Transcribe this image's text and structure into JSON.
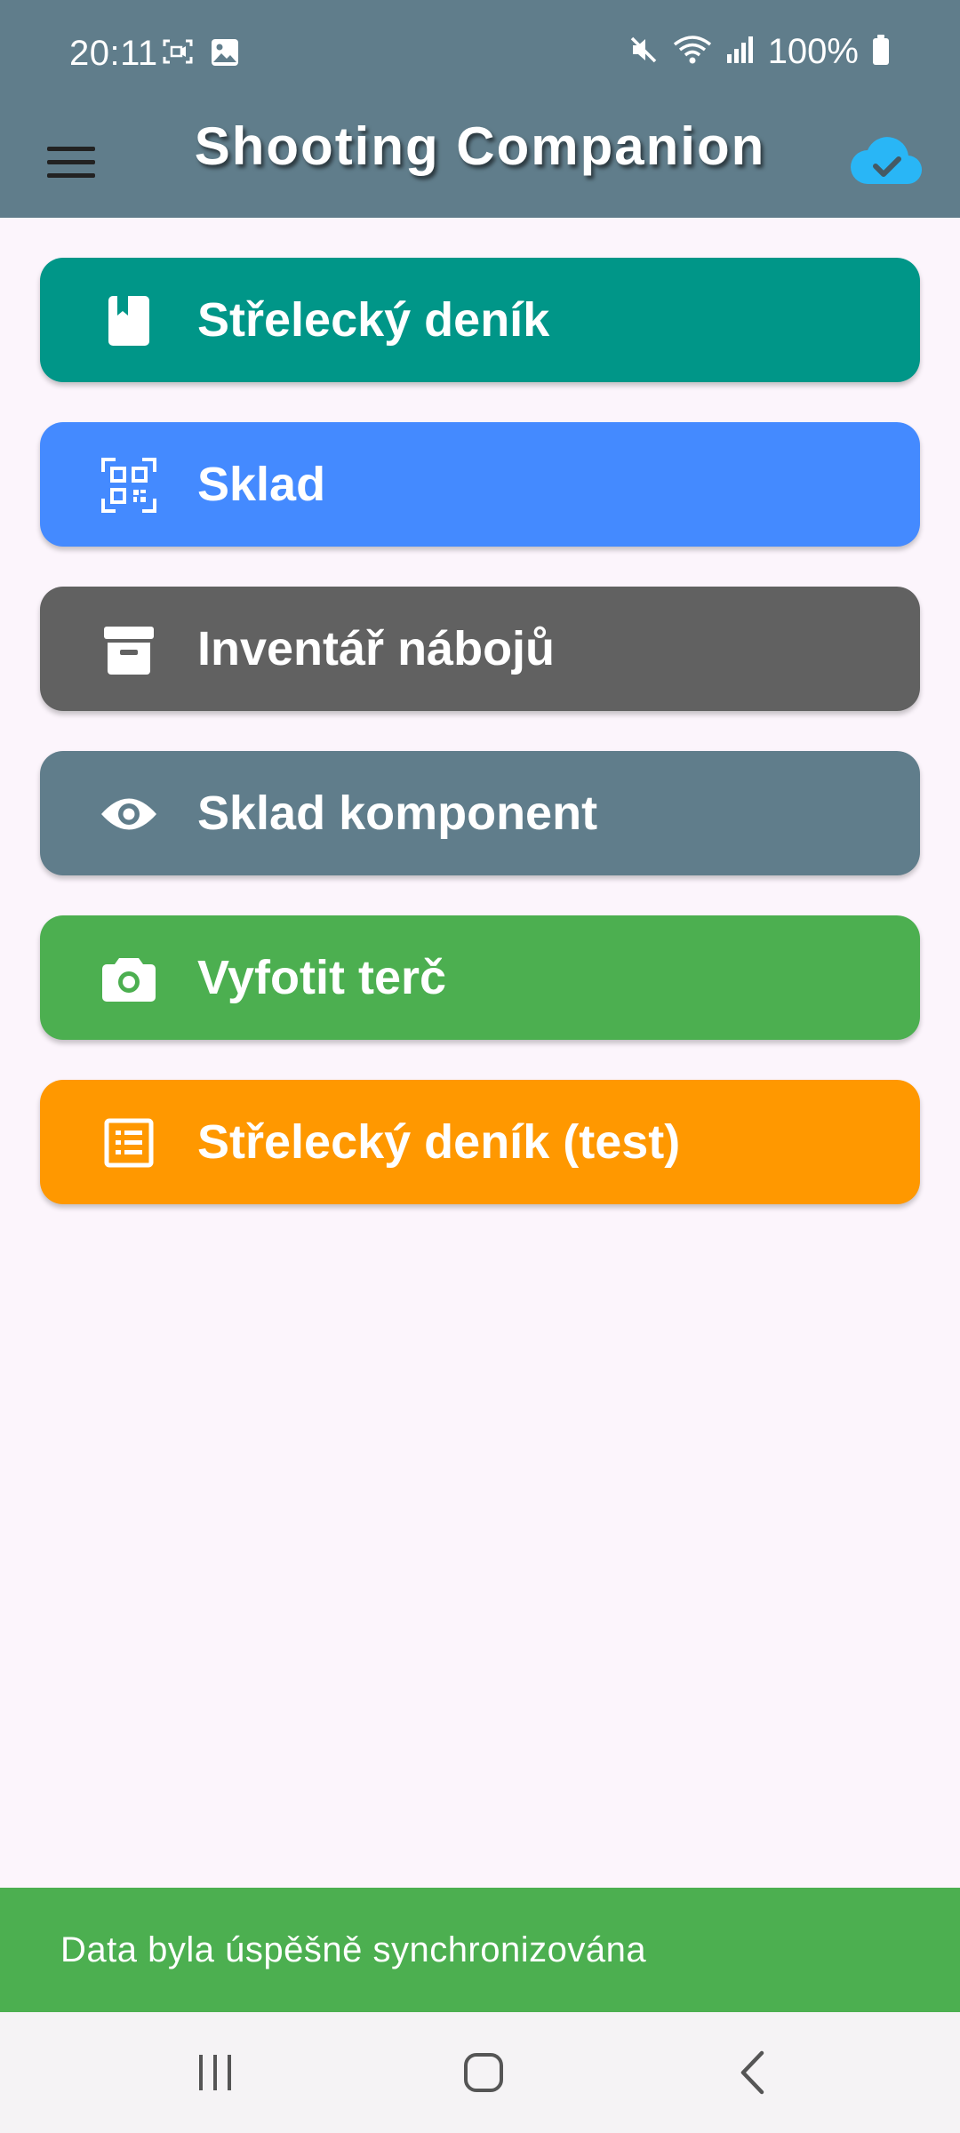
{
  "status_bar": {
    "time": "20:11",
    "left_icons": [
      "screen-record-icon",
      "image-icon"
    ],
    "right_icons": [
      "mute-icon",
      "wifi-icon",
      "signal-icon",
      "battery-icon"
    ],
    "battery": "100%"
  },
  "app_bar": {
    "title": "Shooting Companion",
    "menu_icon": "hamburger-menu-icon",
    "sync_icon": "cloud-done-icon",
    "colors": {
      "background": "#607d8b",
      "sync_icon": "#29b6f6"
    }
  },
  "menu": {
    "items": [
      {
        "label": "Střelecký deník",
        "icon": "book-icon",
        "color": "#009688"
      },
      {
        "label": "Sklad",
        "icon": "qr-code-scan-icon",
        "color": "#448aff"
      },
      {
        "label": "Inventář nábojů",
        "icon": "archive-box-icon",
        "color": "#616161"
      },
      {
        "label": "Sklad komponent",
        "icon": "eye-icon",
        "color": "#607d8b"
      },
      {
        "label": "Vyfotit terč",
        "icon": "camera-icon",
        "color": "#4caf50"
      },
      {
        "label": "Střelecký deník (test)",
        "icon": "list-document-icon",
        "color": "#ff9800"
      }
    ]
  },
  "snackbar": {
    "message": "Data byla úspěšně synchronizována",
    "color": "#4caf50"
  },
  "nav_bar": {
    "buttons": [
      "recent-apps-icon",
      "home-icon",
      "back-icon"
    ]
  }
}
